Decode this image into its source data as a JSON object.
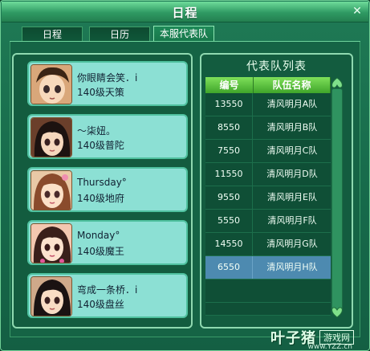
{
  "window": {
    "title": "日程",
    "close_symbol": "✕"
  },
  "tabs": [
    {
      "label": "日程",
      "active": false
    },
    {
      "label": "日历",
      "active": false
    },
    {
      "label": "本服代表队",
      "active": true
    }
  ],
  "members": [
    {
      "name": "你眼睛会笑．i",
      "level": "140级天策",
      "avatar": "avatar-boy-shorthair"
    },
    {
      "name": "～柒妞。",
      "level": "140级普陀",
      "avatar": "avatar-girl-darkhair"
    },
    {
      "name": "Thursday°",
      "level": "140级地府",
      "avatar": "avatar-girl-brownhair"
    },
    {
      "name": "Monday°",
      "level": "140级魔王",
      "avatar": "avatar-girl-flowers"
    },
    {
      "name": "弯成一条桥．i",
      "level": "140级盘丝",
      "avatar": "avatar-girl-blackhair"
    }
  ],
  "team_list": {
    "title": "代表队列表",
    "columns": [
      "编号",
      "队伍名称"
    ],
    "rows": [
      {
        "id": "13550",
        "name": "清风明月A队",
        "selected": false
      },
      {
        "id": "8550",
        "name": "清风明月B队",
        "selected": false
      },
      {
        "id": "7550",
        "name": "清风明月C队",
        "selected": false
      },
      {
        "id": "11550",
        "name": "清风明月D队",
        "selected": false
      },
      {
        "id": "9550",
        "name": "清风明月E队",
        "selected": false
      },
      {
        "id": "5550",
        "name": "清风明月F队",
        "selected": false
      },
      {
        "id": "14550",
        "name": "清风明月G队",
        "selected": false
      },
      {
        "id": "6550",
        "name": "清风明月H队",
        "selected": true
      }
    ]
  },
  "watermark": {
    "brand": "叶子猪",
    "badge": "游戏网",
    "url": "www.YZZ.cn"
  },
  "colors": {
    "window_bg": "#16694a",
    "panel_border": "#8fd9b0",
    "member_card": "#8ce0d4",
    "header_green": "#5fc23f",
    "selected_row": "#4d8ab0"
  }
}
